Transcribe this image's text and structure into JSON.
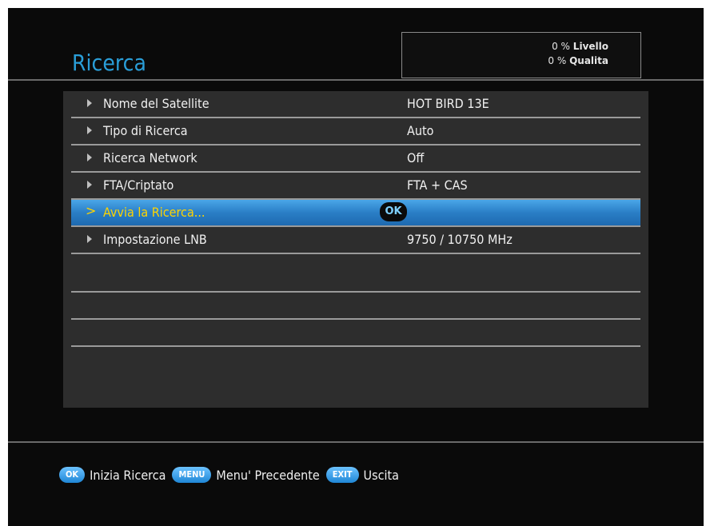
{
  "header": {
    "title": "Ricerca",
    "signal": [
      {
        "value": "0 %",
        "label": "Livello"
      },
      {
        "value": "0 %",
        "label": "Qualita"
      }
    ]
  },
  "menu": {
    "items": [
      {
        "label": "Nome del Satellite",
        "value": "HOT BIRD 13E"
      },
      {
        "label": "Tipo di Ricerca",
        "value": "Auto"
      },
      {
        "label": "Ricerca Network",
        "value": "Off"
      },
      {
        "label": "FTA/Criptato",
        "value": "FTA + CAS"
      },
      {
        "label": "Avvia la Ricerca...",
        "value": "",
        "badge": "OK",
        "selected": true
      },
      {
        "label": "Impostazione LNB",
        "value": "9750 / 10750 MHz"
      }
    ]
  },
  "footer": {
    "hints": [
      {
        "key": "OK",
        "label": "Inizia Ricerca"
      },
      {
        "key": "MENU",
        "label": "Menu' Precedente"
      },
      {
        "key": "EXIT",
        "label": "Uscita"
      }
    ]
  },
  "colors": {
    "title": "#2a9ed8",
    "selected_row": "#2a7ec6",
    "selected_text": "#ffd400"
  }
}
